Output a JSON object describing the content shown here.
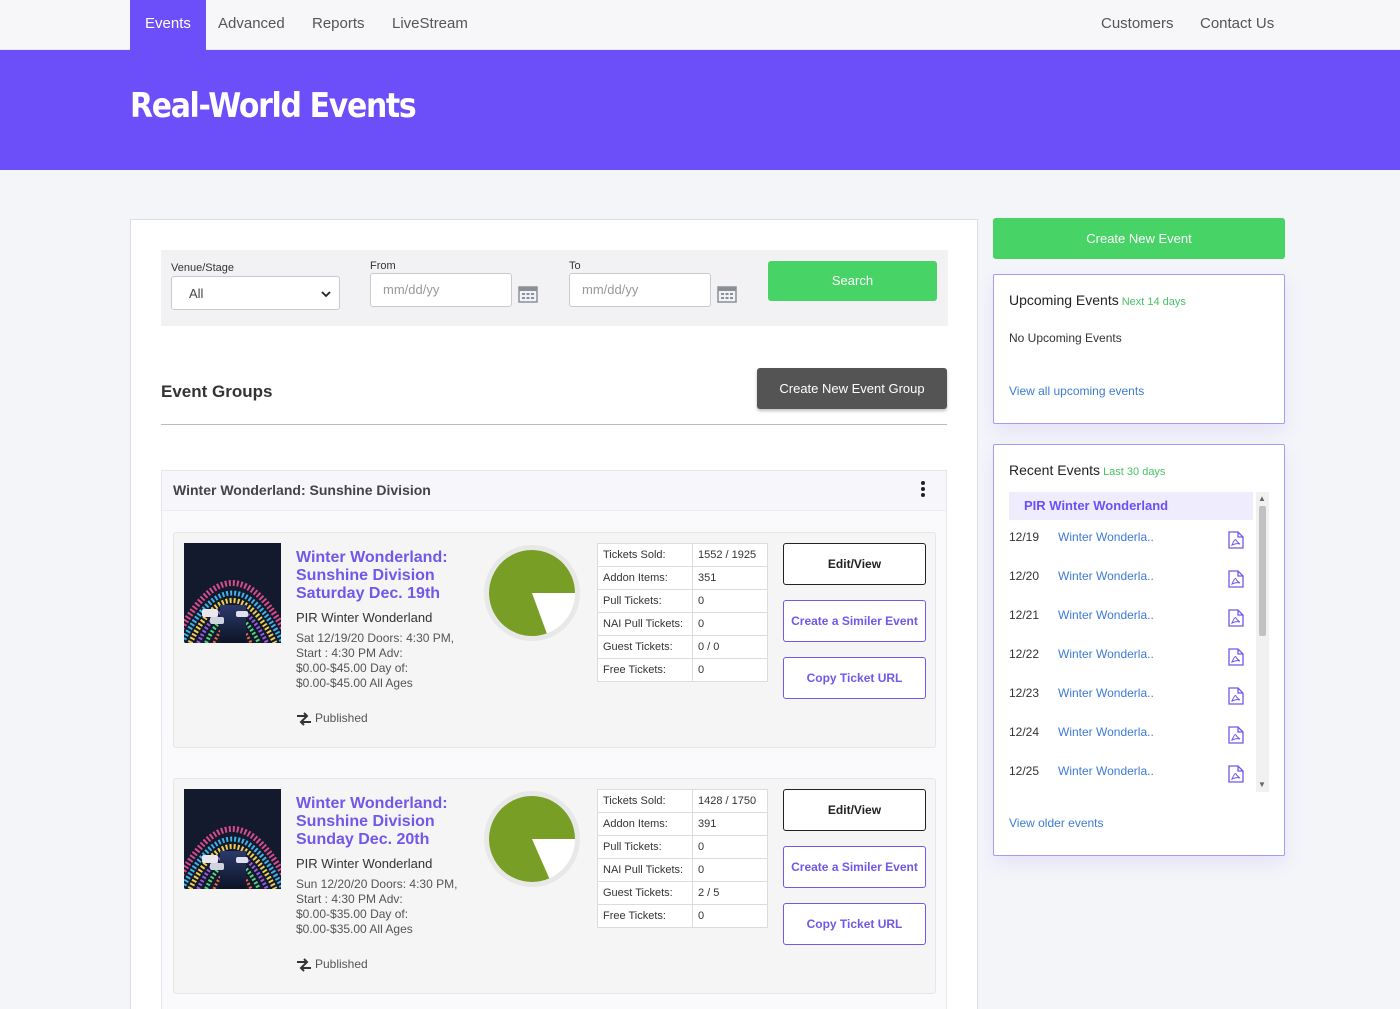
{
  "nav": {
    "left": [
      "Events",
      "Advanced",
      "Reports",
      "LiveStream"
    ],
    "right": [
      "Customers",
      "Contact Us"
    ],
    "active": "Events"
  },
  "hero": {
    "title": "Real-World Events"
  },
  "filters": {
    "venue_label": "Venue/Stage",
    "venue_value": "All",
    "from_label": "From",
    "from_placeholder": "mm/dd/yy",
    "to_label": "To",
    "to_placeholder": "mm/dd/yy",
    "search_label": "Search"
  },
  "groups": {
    "section_title": "Event Groups",
    "create_group_label": "Create New Event Group",
    "group_title": "Winter Wonderland: Sunshine Division"
  },
  "events": [
    {
      "title": "Winter Wonderland: Sunshine Division Saturday Dec. 19th",
      "venue": "PIR Winter Wonderland",
      "details": "Sat 12/19/20 Doors: 4:30 PM, Start : 4:30 PM Adv: $0.00-$45.00 Day of: $0.00-$45.00 All Ages",
      "status": "Published",
      "sold_fraction": 0.806,
      "stats": [
        {
          "label": "Tickets Sold:",
          "value": "1552 / 1925"
        },
        {
          "label": "Addon Items:",
          "value": "351"
        },
        {
          "label": "Pull Tickets:",
          "value": "0"
        },
        {
          "label": "NAI Pull Tickets:",
          "value": "0"
        },
        {
          "label": "Guest Tickets:",
          "value": "0 / 0"
        },
        {
          "label": "Free Tickets:",
          "value": "0"
        }
      ],
      "edit_label": "Edit/View",
      "similar_label": "Create a Similer Event",
      "copy_label": "Copy Ticket URL"
    },
    {
      "title": "Winter Wonderland: Sunshine Division Sunday Dec. 20th",
      "venue": "PIR Winter Wonderland",
      "details": "Sun 12/20/20 Doors: 4:30 PM, Start : 4:30 PM Adv: $0.00-$35.00 Day of: $0.00-$35.00 All Ages",
      "status": "Published",
      "sold_fraction": 0.816,
      "stats": [
        {
          "label": "Tickets Sold:",
          "value": "1428 / 1750"
        },
        {
          "label": "Addon Items:",
          "value": "391"
        },
        {
          "label": "Pull Tickets:",
          "value": "0"
        },
        {
          "label": "NAI Pull Tickets:",
          "value": "0"
        },
        {
          "label": "Guest Tickets:",
          "value": "2 / 5"
        },
        {
          "label": "Free Tickets:",
          "value": "0"
        }
      ],
      "edit_label": "Edit/View",
      "similar_label": "Create a Similer Event",
      "copy_label": "Copy Ticket URL"
    }
  ],
  "sidebar": {
    "create_event_label": "Create New Event",
    "upcoming": {
      "title": "Upcoming Events",
      "subtitle": "Next 14 days",
      "empty_text": "No Upcoming Events",
      "link": "View all upcoming events"
    },
    "recent": {
      "title": "Recent Events",
      "subtitle": "Last 30 days",
      "group_name": "PIR Winter Wonderland",
      "items": [
        {
          "date": "12/19",
          "name": "Winter Wonderla.."
        },
        {
          "date": "12/20",
          "name": "Winter Wonderla.."
        },
        {
          "date": "12/21",
          "name": "Winter Wonderla.."
        },
        {
          "date": "12/22",
          "name": "Winter Wonderla.."
        },
        {
          "date": "12/23",
          "name": "Winter Wonderla.."
        },
        {
          "date": "12/24",
          "name": "Winter Wonderla.."
        },
        {
          "date": "12/25",
          "name": "Winter Wonderla.."
        }
      ],
      "link": "View older events"
    }
  },
  "colors": {
    "brand": "#6c4ff9",
    "green": "#47d365",
    "pie_fill": "#789e25",
    "link": "#3d7bd6"
  }
}
